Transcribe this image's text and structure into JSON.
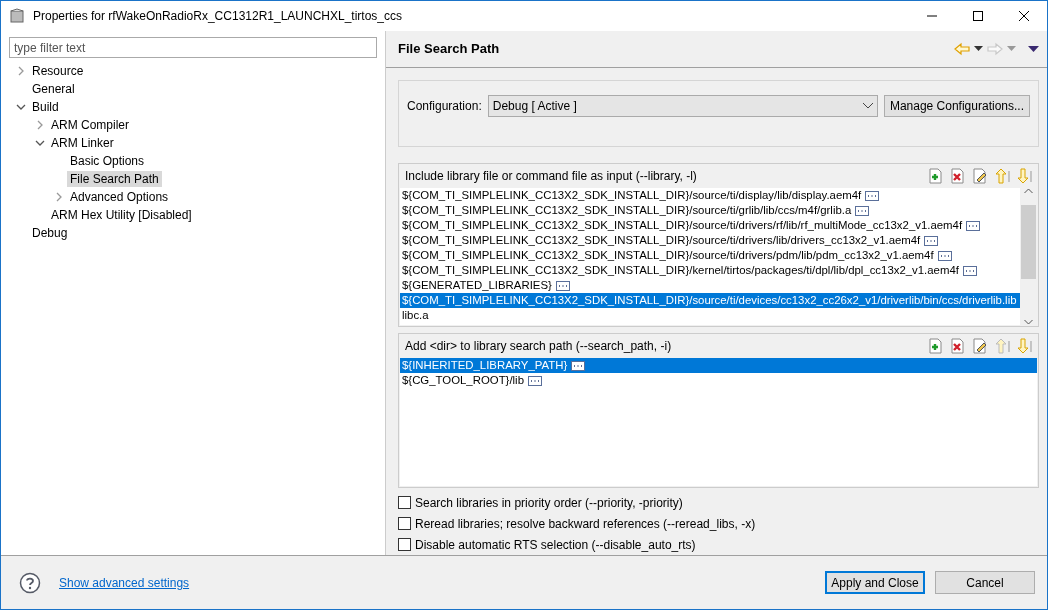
{
  "window": {
    "title": "Properties for rfWakeOnRadioRx_CC1312R1_LAUNCHXL_tirtos_ccs"
  },
  "filter": {
    "placeholder": "type filter text"
  },
  "tree": [
    {
      "label": "Resource",
      "expanded": false,
      "selected": false
    },
    {
      "label": "General",
      "selected": false
    },
    {
      "label": "Build",
      "expanded": true,
      "selected": false,
      "children": [
        {
          "label": "ARM Compiler",
          "expanded": false,
          "selected": false
        },
        {
          "label": "ARM Linker",
          "expanded": true,
          "selected": false,
          "children": [
            {
              "label": "Basic Options",
              "selected": false
            },
            {
              "label": "File Search Path",
              "selected": true
            },
            {
              "label": "Advanced Options",
              "expanded": false,
              "selected": false
            }
          ]
        },
        {
          "label": "ARM Hex Utility  [Disabled]",
          "selected": false
        }
      ]
    },
    {
      "label": "Debug",
      "selected": false
    }
  ],
  "page": {
    "title": "File Search Path",
    "nav": [
      {
        "kind": "back",
        "disabled": false
      },
      {
        "kind": "forward",
        "disabled": true
      }
    ]
  },
  "configuration": {
    "label": "Configuration:",
    "value": "Debug  [ Active ]",
    "button": "Manage Configurations..."
  },
  "lists": [
    {
      "title": "Include library file or command file as input (--library, -l)",
      "scrollable": true,
      "tools": [
        {
          "kind": "add",
          "disabled": false
        },
        {
          "kind": "delete",
          "disabled": false
        },
        {
          "kind": "edit",
          "disabled": false
        },
        {
          "kind": "up",
          "disabled": false
        },
        {
          "kind": "down",
          "disabled": false
        }
      ],
      "rows": [
        {
          "text": "${COM_TI_SIMPLELINK_CC13X2_SDK_INSTALL_DIR}/source/ti/display/lib/display.aem4f",
          "more": true,
          "selected": false
        },
        {
          "text": "${COM_TI_SIMPLELINK_CC13X2_SDK_INSTALL_DIR}/source/ti/grlib/lib/ccs/m4f/grlib.a",
          "more": true,
          "selected": false
        },
        {
          "text": "${COM_TI_SIMPLELINK_CC13X2_SDK_INSTALL_DIR}/source/ti/drivers/rf/lib/rf_multiMode_cc13x2_v1.aem4f",
          "more": true,
          "selected": false
        },
        {
          "text": "${COM_TI_SIMPLELINK_CC13X2_SDK_INSTALL_DIR}/source/ti/drivers/lib/drivers_cc13x2_v1.aem4f",
          "more": true,
          "selected": false
        },
        {
          "text": "${COM_TI_SIMPLELINK_CC13X2_SDK_INSTALL_DIR}/source/ti/drivers/pdm/lib/pdm_cc13x2_v1.aem4f",
          "more": true,
          "selected": false
        },
        {
          "text": "${COM_TI_SIMPLELINK_CC13X2_SDK_INSTALL_DIR}/kernel/tirtos/packages/ti/dpl/lib/dpl_cc13x2_v1.aem4f",
          "more": true,
          "selected": false
        },
        {
          "text": "${GENERATED_LIBRARIES}",
          "more": true,
          "selected": false
        },
        {
          "text": "${COM_TI_SIMPLELINK_CC13X2_SDK_INSTALL_DIR}/source/ti/devices/cc13x2_cc26x2_v1/driverlib/bin/ccs/driverlib.lib",
          "more": false,
          "selected": true
        },
        {
          "text": "libc.a",
          "more": false,
          "selected": false
        }
      ]
    },
    {
      "title": "Add <dir> to library search path (--search_path, -i)",
      "scrollable": false,
      "tools": [
        {
          "kind": "add",
          "disabled": false
        },
        {
          "kind": "delete",
          "disabled": false
        },
        {
          "kind": "edit",
          "disabled": false
        },
        {
          "kind": "up",
          "disabled": true
        },
        {
          "kind": "down",
          "disabled": false
        }
      ],
      "rows": [
        {
          "text": "${INHERITED_LIBRARY_PATH}",
          "more": true,
          "selected": true
        },
        {
          "text": "${CG_TOOL_ROOT}/lib",
          "more": true,
          "selected": false
        }
      ]
    }
  ],
  "options": [
    {
      "label": "Search libraries in priority order (--priority, -priority)",
      "checked": false
    },
    {
      "label": "Reread libraries; resolve backward references (--reread_libs, -x)",
      "checked": false
    },
    {
      "label": "Disable automatic RTS selection (--disable_auto_rts)",
      "checked": false
    }
  ],
  "footer": {
    "link": "Show advanced settings",
    "buttons": [
      {
        "label": "Apply and Close",
        "selected": true
      },
      {
        "label": "Cancel",
        "selected": false
      }
    ]
  }
}
